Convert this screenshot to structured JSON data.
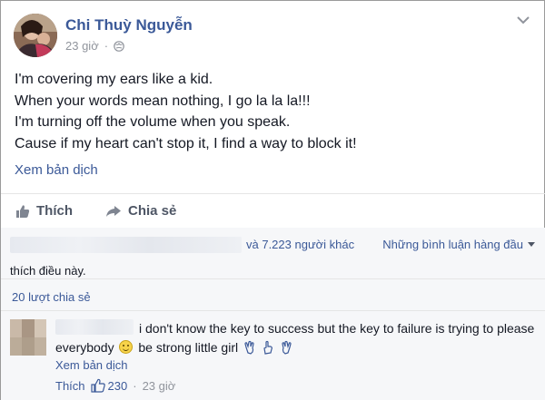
{
  "post": {
    "author": "Chi Thuỳ Nguyễn",
    "time": "23 giờ",
    "separator": "·",
    "lines": [
      "I'm covering my ears like a kid.",
      "When your words mean nothing, I go la la la!!!",
      "I'm turning off the volume when you speak.",
      "Cause if my heart can't stop it, I find a way to block it!"
    ],
    "translate_label": "Xem bản dịch"
  },
  "actions": {
    "like_label": "Thích",
    "share_label": "Chia sẻ"
  },
  "feedback": {
    "others_text": "và 7.223 người khác",
    "sort_label": "Những bình luận hàng đầu",
    "likes_suffix": "thích điều này.",
    "shares_text": "20 lượt chia sẻ"
  },
  "comment": {
    "text_part1": "i don't know the key to success but the key to failure is trying to please everybody",
    "text_part2": "be strong little girl",
    "translate_label": "Xem bản dịch",
    "like_label": "Thích",
    "like_count": "230",
    "separator": "·",
    "time": "23 giờ"
  },
  "colors": {
    "link": "#3b5998",
    "text": "#141823",
    "muted": "#90949c",
    "feedback_bg": "#f6f7f9"
  },
  "icons": [
    "globe-icon",
    "chevron-down-icon",
    "thumbs-up-icon",
    "share-arrow-icon",
    "smiley-icon",
    "hand-icon"
  ]
}
